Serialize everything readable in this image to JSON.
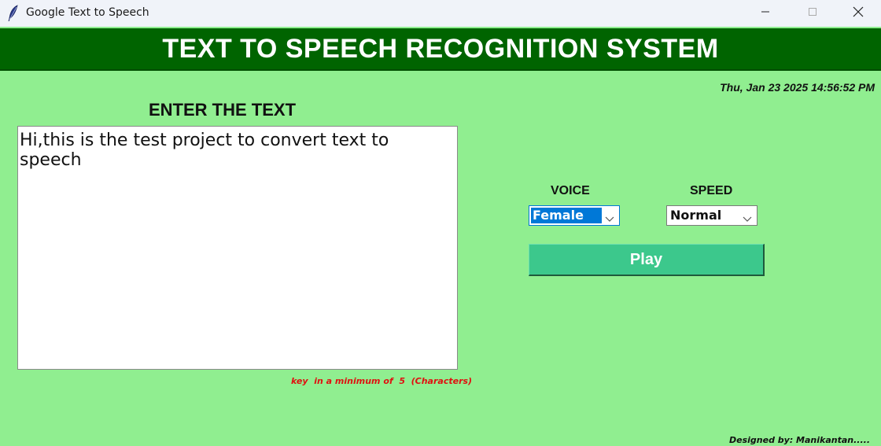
{
  "window": {
    "title": "Google Text to Speech",
    "icon": "feather-icon",
    "controls": [
      "minimize-icon",
      "maximize-icon",
      "close-icon"
    ]
  },
  "header": {
    "title": "TEXT TO SPEECH RECOGNITION SYSTEM",
    "background": "#006400"
  },
  "datetime": "Thu, Jan 23 2025 14:56:52 PM",
  "input": {
    "label": "ENTER THE TEXT",
    "value": "Hi,this is the test project to convert text to speech",
    "hint": "key  in a minimum of  5  (Characters)"
  },
  "voice": {
    "label": "VOICE",
    "selected": "Female"
  },
  "speed": {
    "label": "SPEED",
    "selected": "Normal"
  },
  "play": {
    "label": "Play",
    "color": "#3cc88c"
  },
  "footer": "Designed by: Manikantan.....",
  "colors": {
    "background": "#90ee90",
    "accent": "#0078d7",
    "hint": "#e01010"
  }
}
